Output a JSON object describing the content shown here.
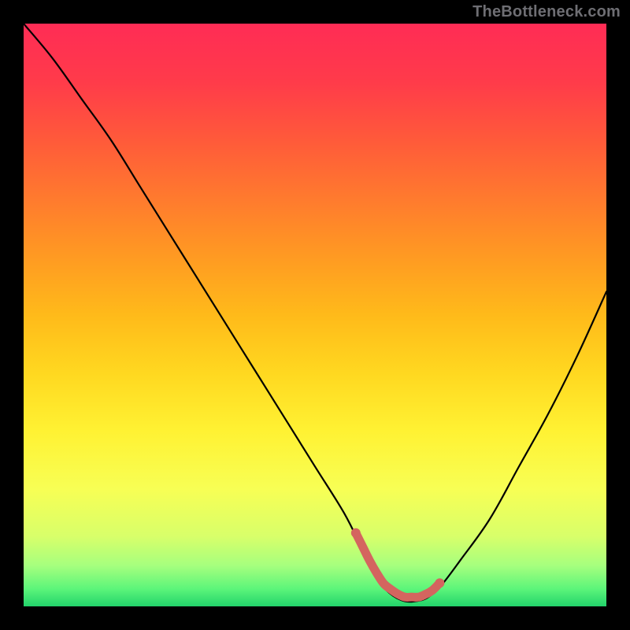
{
  "watermark": "TheBottleneck.com",
  "gradient": {
    "stops": [
      {
        "offset": 0.0,
        "color": "#ff2c55"
      },
      {
        "offset": 0.1,
        "color": "#ff3b4a"
      },
      {
        "offset": 0.2,
        "color": "#ff5a3a"
      },
      {
        "offset": 0.3,
        "color": "#ff7a2e"
      },
      {
        "offset": 0.4,
        "color": "#ff9a22"
      },
      {
        "offset": 0.5,
        "color": "#ffba1a"
      },
      {
        "offset": 0.6,
        "color": "#ffd820"
      },
      {
        "offset": 0.7,
        "color": "#fff233"
      },
      {
        "offset": 0.8,
        "color": "#f7ff55"
      },
      {
        "offset": 0.88,
        "color": "#d8ff6a"
      },
      {
        "offset": 0.93,
        "color": "#a6ff7e"
      },
      {
        "offset": 0.97,
        "color": "#5cf57a"
      },
      {
        "offset": 1.0,
        "color": "#22d36b"
      }
    ]
  },
  "chart_data": {
    "type": "line",
    "title": "",
    "xlabel": "",
    "ylabel": "",
    "xlim": [
      0,
      100
    ],
    "ylim": [
      0,
      100
    ],
    "series": [
      {
        "name": "bottleneck-curve",
        "x": [
          0,
          5,
          10,
          15,
          20,
          25,
          30,
          35,
          40,
          45,
          50,
          55,
          58,
          60,
          62,
          65,
          68,
          70,
          72,
          75,
          80,
          85,
          90,
          95,
          100
        ],
        "y": [
          100,
          94,
          87,
          80,
          72,
          64,
          56,
          48,
          40,
          32,
          24,
          16,
          10,
          6,
          3,
          1,
          1,
          2,
          4,
          8,
          15,
          24,
          33,
          43,
          54
        ]
      }
    ],
    "highlight": {
      "name": "optimal-zone",
      "color": "#d4655f",
      "xrange": [
        57,
        72
      ],
      "hump_ylift": 0.6
    }
  }
}
